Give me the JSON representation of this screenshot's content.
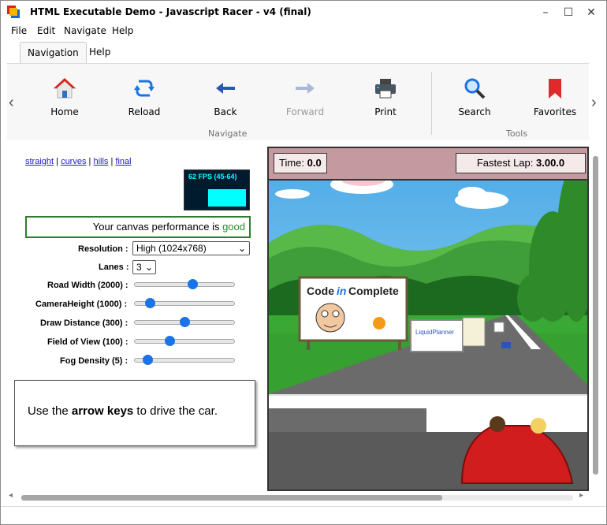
{
  "window": {
    "title": "HTML Executable Demo - Javascript Racer - v4 (final)",
    "controls": {
      "minimize": "–",
      "maximize": "☐",
      "close": "✕"
    }
  },
  "menu": [
    "File",
    "Edit",
    "Navigate",
    "Help"
  ],
  "ribbon": {
    "tabs": [
      "Navigation",
      "Help"
    ],
    "active_tab": "Navigation",
    "buttons": [
      {
        "label": "Home",
        "icon": "home-icon",
        "enabled": true
      },
      {
        "label": "Reload",
        "icon": "reload-icon",
        "enabled": true
      },
      {
        "label": "Back",
        "icon": "back-arrow-icon",
        "enabled": true
      },
      {
        "label": "Forward",
        "icon": "forward-arrow-icon",
        "enabled": false
      },
      {
        "label": "Print",
        "icon": "printer-icon",
        "enabled": true
      },
      {
        "label": "Search",
        "icon": "search-icon",
        "enabled": true
      },
      {
        "label": "Favorites",
        "icon": "bookmark-icon",
        "enabled": true
      }
    ],
    "groups": [
      "Navigate",
      "Tools"
    ]
  },
  "page": {
    "links": [
      "straight",
      "curves",
      "hills",
      "final"
    ],
    "link_separator": "|",
    "fps": "62 FPS (45-64)",
    "performance_prefix": "Your canvas performance is ",
    "performance_value": "good",
    "resolution": {
      "label": "Resolution :",
      "value": "High (1024x768)"
    },
    "lanes": {
      "label": "Lanes :",
      "value": "3"
    },
    "sliders": [
      {
        "label": "Road Width (2000) :",
        "level": 0.58
      },
      {
        "label": "CameraHeight (1000) :",
        "level": 0.15
      },
      {
        "label": "Draw Distance (300) :",
        "level": 0.5
      },
      {
        "label": "Field of View (100) :",
        "level": 0.35
      },
      {
        "label": "Fog Density (5) :",
        "level": 0.13
      }
    ],
    "hint_pre": "Use the ",
    "hint_bold": "arrow keys",
    "hint_post": " to drive the car."
  },
  "game": {
    "time_label": "Time:",
    "time_value": "0.0",
    "lap_label": "Fastest Lap:",
    "lap_value": "3.00.0",
    "billboard_1_title_a": "Code ",
    "billboard_1_title_b": "in",
    "billboard_1_title_c": "Complete",
    "billboard_2_text": "LiquidPlanner"
  },
  "colors": {
    "accent": "#1a73e8",
    "sky": "#6ec3ec",
    "grass": "#3aa835",
    "road": "#6b6b6b",
    "hud": "#c49aa0"
  }
}
